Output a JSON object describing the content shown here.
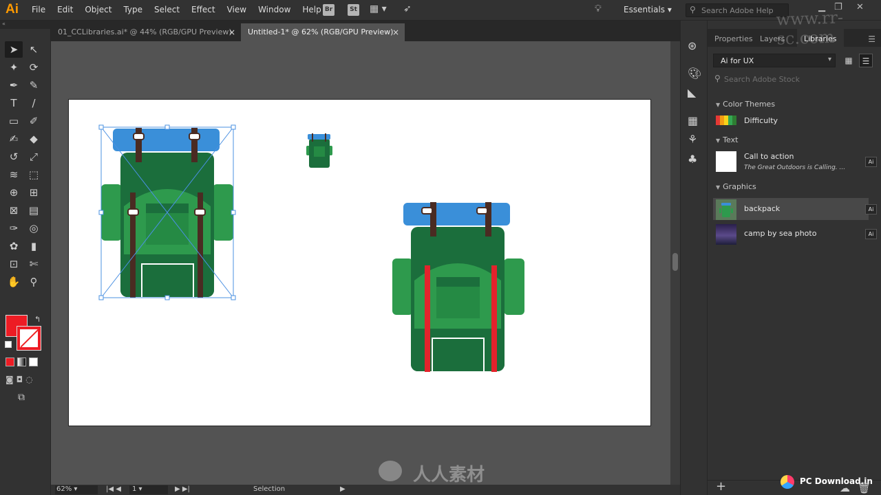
{
  "app": {
    "logo": "Ai",
    "menu": [
      "File",
      "Edit",
      "Object",
      "Type",
      "Select",
      "Effect",
      "View",
      "Window",
      "Help"
    ],
    "bridge_label": "Br",
    "stock_label": "St",
    "workspace": "Essentials",
    "search_placeholder": "Search Adobe Help"
  },
  "documents": {
    "tabs": [
      {
        "label": "01_CCLibraries.ai* @ 44% (RGB/GPU Preview)",
        "active": false
      },
      {
        "label": "Untitled-1* @ 62% (RGB/GPU Preview)",
        "active": true
      }
    ],
    "close_glyph": "×"
  },
  "tools": {
    "fill_color": "#ed1c24",
    "stroke_color": "#ed1c24",
    "icons": [
      "selection-icon",
      "direct-selection-icon",
      "magic-wand-icon",
      "lasso-icon",
      "pen-icon",
      "curvature-icon",
      "type-icon",
      "line-icon",
      "rectangle-icon",
      "paintbrush-icon",
      "shaper-icon",
      "eraser-icon",
      "rotate-icon",
      "scale-icon",
      "warp-icon",
      "free-transform-icon",
      "shape-builder-icon",
      "perspective-icon",
      "mesh-icon",
      "gradient-icon",
      "eyedropper-icon",
      "blend-icon",
      "symbol-sprayer-icon",
      "graph-icon",
      "artboard-icon",
      "slice-icon",
      "hand-icon",
      "zoom-icon"
    ],
    "glyphs": [
      "➤",
      "↖",
      "✦",
      "⟳",
      "✒",
      "✎",
      "T",
      "/",
      "▭",
      "✐",
      "✍",
      "◆",
      "↺",
      "⤢",
      "≋",
      "⬚",
      "⊕",
      "⊞",
      "⊠",
      "▤",
      "✑",
      "◎",
      "✿",
      "▮",
      "⊡",
      "✄",
      "✋",
      "⚲"
    ]
  },
  "status": {
    "zoom": "62%",
    "page": "1",
    "tool": "Selection"
  },
  "panel": {
    "tabs": [
      "Properties",
      "Layers",
      "Libraries"
    ],
    "active_tab": "Libraries",
    "library": "Ai for UX",
    "stock_placeholder": "Search Adobe Stock",
    "sections": {
      "color_themes": "Color Themes",
      "text": "Text",
      "graphics": "Graphics"
    },
    "color_theme": {
      "name": "Difficulty",
      "swatches": [
        "#e53935",
        "#f39c12",
        "#f7d31a",
        "#34a853",
        "#2e7d32"
      ]
    },
    "text_item": {
      "name": "Call to action",
      "sample": "The Great Outdoors is Calling. ...",
      "badge": "Ai"
    },
    "graphics": [
      {
        "name": "backpack",
        "badge": "Ai",
        "selected": true
      },
      {
        "name": "camp by sea photo",
        "badge": "Ai",
        "selected": false
      }
    ]
  },
  "watermark": {
    "site": "www.rr-sc.com",
    "brand": "人人素材",
    "pc_download": "PC Download.in"
  },
  "colors": {
    "backpack_green_dark": "#1b6e3c",
    "backpack_green": "#2e9a4d",
    "backpack_green_mid": "#258a44",
    "backpack_blue": "#3a8fd9",
    "strap_brown": "#4a2b22",
    "strap_red": "#e3232c"
  }
}
